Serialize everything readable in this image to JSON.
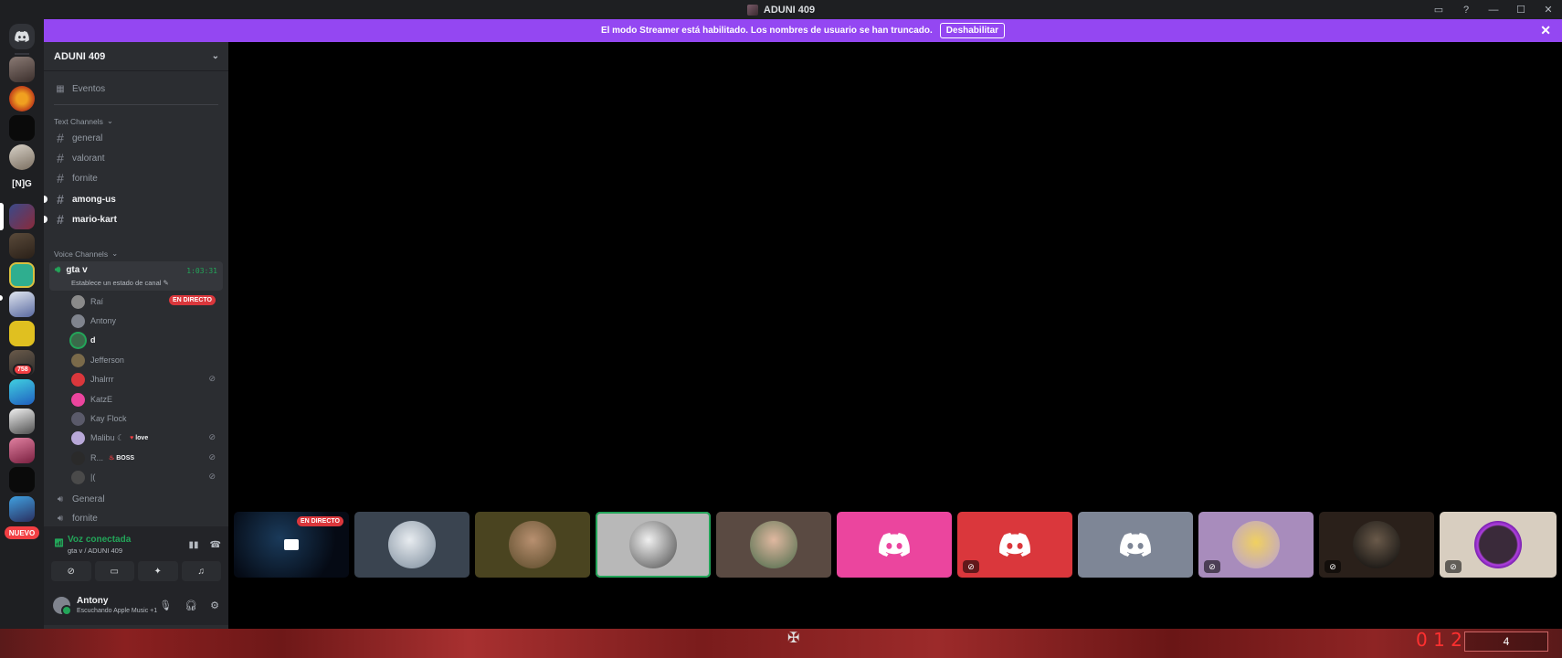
{
  "window": {
    "title": "ADUNI 409",
    "controls": [
      "▭",
      "?",
      "—",
      "☐",
      "✕"
    ]
  },
  "banner": {
    "text": "El modo Streamer está habilitado. Los nombres de usuario se han truncado.",
    "button": "Deshabilitar",
    "close": "✕"
  },
  "rail": {
    "server_mention_badge": "758",
    "ng_label": "[N]G",
    "new_label": "NUEVO"
  },
  "server": {
    "name": "ADUNI 409",
    "events_label": "Eventos",
    "text_category": "Text Channels",
    "voice_category": "Voice Channels",
    "text_channels": [
      "general",
      "valorant",
      "fornite",
      "among-us",
      "mario-kart"
    ],
    "voice_channel": {
      "name": "gta v",
      "timer": "1:03:31",
      "status": "Establece un estado de canal"
    },
    "voice_users": [
      {
        "name": "Raí",
        "badge": "EN DIRECTO"
      },
      {
        "name": "Antony"
      },
      {
        "name": "d"
      },
      {
        "name": "Jefferson"
      },
      {
        "name": "Jhalrrr"
      },
      {
        "name": "KatzE"
      },
      {
        "name": "Kay Flock"
      },
      {
        "name": "Malibu ☾",
        "tag": "love"
      },
      {
        "name": "R...",
        "tag": "BOSS"
      },
      {
        "name": "|("
      }
    ],
    "other_voice": [
      "General",
      "fornite"
    ]
  },
  "voice_panel": {
    "title": "Voz conectada",
    "subtitle": "gta v / ADUNI 409"
  },
  "user": {
    "name": "Antony",
    "status": "Escuchando Apple Music +1"
  },
  "tiles": {
    "live_label": "EN DIRECTO"
  },
  "game": {
    "score": "0 1 2",
    "box": "4"
  }
}
